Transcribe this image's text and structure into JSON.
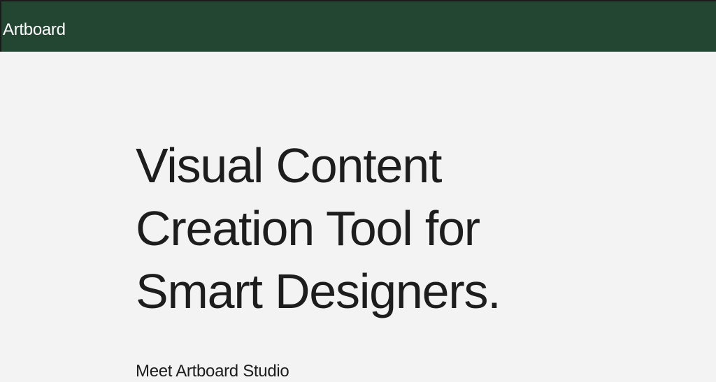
{
  "header": {
    "brand": "Artboard",
    "background_color": "#234632"
  },
  "hero": {
    "lines": [
      "Visual Content",
      "Creation Tool for",
      "Smart Designers."
    ]
  },
  "subtitle": "Meet Artboard Studio"
}
